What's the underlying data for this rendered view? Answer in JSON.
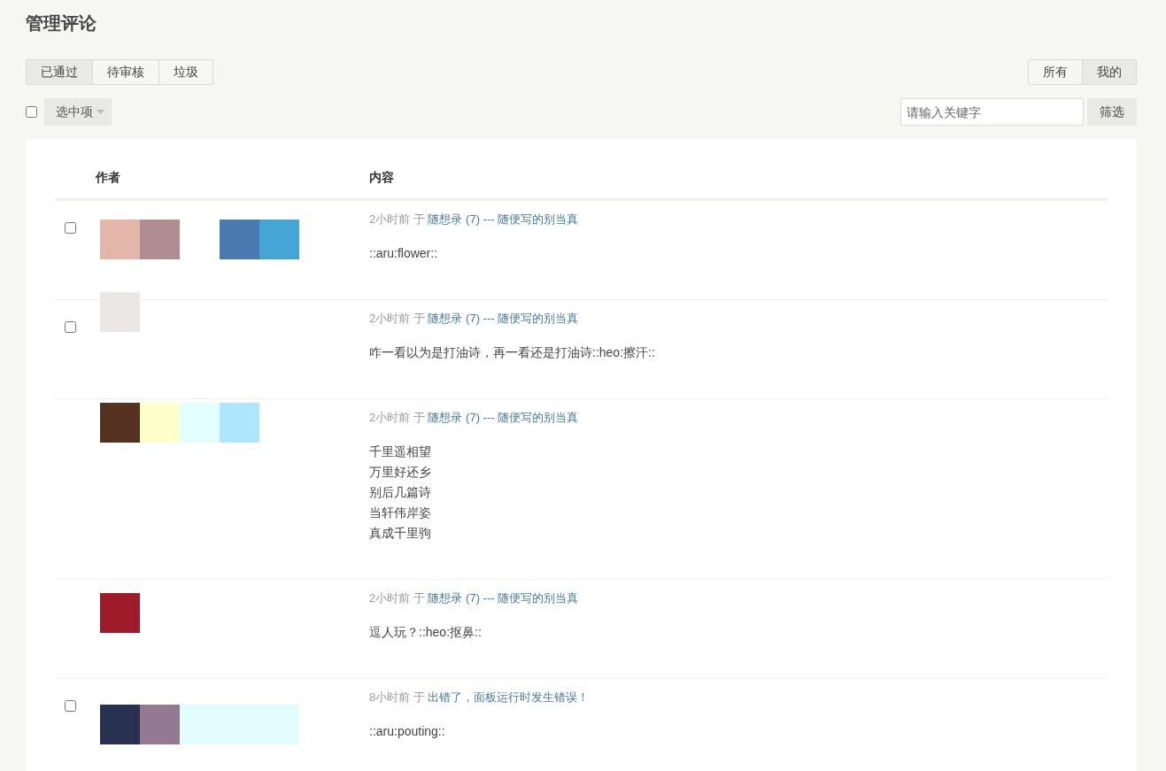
{
  "title": "管理评论",
  "status_tabs": [
    {
      "label": "已通过",
      "selected": true
    },
    {
      "label": "待审核",
      "selected": false
    },
    {
      "label": "垃圾",
      "selected": false
    }
  ],
  "scope_tabs": [
    {
      "label": "所有",
      "selected": false
    },
    {
      "label": "我的",
      "selected": true
    }
  ],
  "select_all": {
    "checked": false
  },
  "bulk_action": {
    "label": "选中项"
  },
  "search": {
    "placeholder": "请输入关键字"
  },
  "filter_button": "筛选",
  "table": {
    "columns": [
      "作者",
      "内容"
    ],
    "rows": [
      {
        "checked": false,
        "time": "2小时前",
        "preposition": "于",
        "post": "随想录 (7) --- 随便写的别当真",
        "lines": [
          "::aru:flower::"
        ]
      },
      {
        "checked": false,
        "time": "2小时前",
        "preposition": "于",
        "post": "随想录 (7) --- 随便写的别当真",
        "lines": [
          "咋一看以为是打油诗，再一看还是打油诗::heo:擦汗::"
        ]
      },
      {
        "time": "2小时前",
        "preposition": "于",
        "post": "随想录 (7) --- 随便写的别当真",
        "lines": [
          "千里遥相望",
          "万里好还乡",
          "别后几篇诗",
          "当轩伟岸姿",
          "真成千里驹"
        ]
      },
      {
        "time": "2小时前",
        "preposition": "于",
        "post": "随想录 (7) --- 随便写的别当真",
        "lines": [
          "逗人玩？::heo:抠鼻::"
        ]
      },
      {
        "checked": false,
        "time": "8小时前",
        "preposition": "于",
        "post": "出错了，面板运行时发生错误！",
        "lines": [
          "::aru:pouting::"
        ]
      }
    ]
  }
}
